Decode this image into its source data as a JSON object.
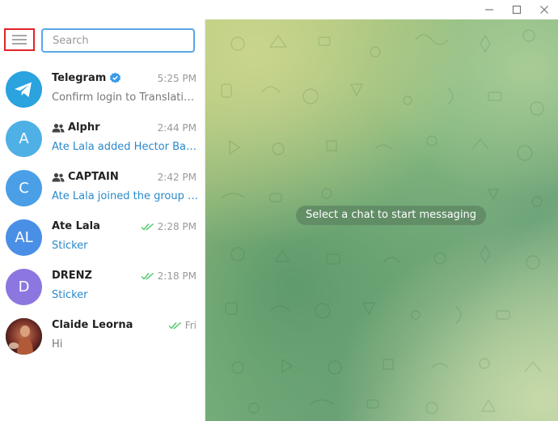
{
  "titlebar": {
    "icons": [
      "minimize-icon",
      "maximize-icon",
      "close-icon"
    ]
  },
  "sidebar": {
    "search_placeholder": "Search",
    "chats": [
      {
        "name": "Telegram",
        "time": "5:25 PM",
        "preview": "Confirm login to Translations...",
        "avatar_type": "telegram-logo",
        "verified": true,
        "group": false,
        "read": false,
        "preview_accent": false,
        "avatar_color": "#2aa3df"
      },
      {
        "name": "Alphr",
        "time": "2:44 PM",
        "preview": "Ate Lala added Hector Barbo...",
        "avatar_letter": "A",
        "group": true,
        "read": false,
        "preview_accent": true,
        "avatar_color": "#4fb0e6"
      },
      {
        "name": "CAPTAIN",
        "time": "2:42 PM",
        "preview": "Ate Lala joined the group via ...",
        "avatar_letter": "C",
        "group": true,
        "read": false,
        "preview_accent": true,
        "avatar_color": "#4a9fe6"
      },
      {
        "name": "Ate Lala",
        "time": "2:28 PM",
        "preview": "Sticker",
        "avatar_letter": "AL",
        "group": false,
        "read": true,
        "preview_accent": true,
        "avatar_color": "#4a8fe6"
      },
      {
        "name": "DRENZ",
        "time": "2:18 PM",
        "preview": "Sticker",
        "avatar_letter": "D",
        "group": false,
        "read": true,
        "preview_accent": true,
        "avatar_color": "#8c77e0"
      },
      {
        "name": "Claide Leorna",
        "time": "Fri",
        "preview": "Hi",
        "avatar_type": "photo",
        "group": false,
        "read": true,
        "preview_accent": false,
        "avatar_color": "#6b2a2a"
      }
    ]
  },
  "main": {
    "empty_message": "Select a chat to start messaging"
  },
  "colors": {
    "accent": "#2a89c9",
    "read_check": "#4fc76b",
    "menu_highlight": "#e3222a",
    "search_border": "#5aa7e6"
  }
}
